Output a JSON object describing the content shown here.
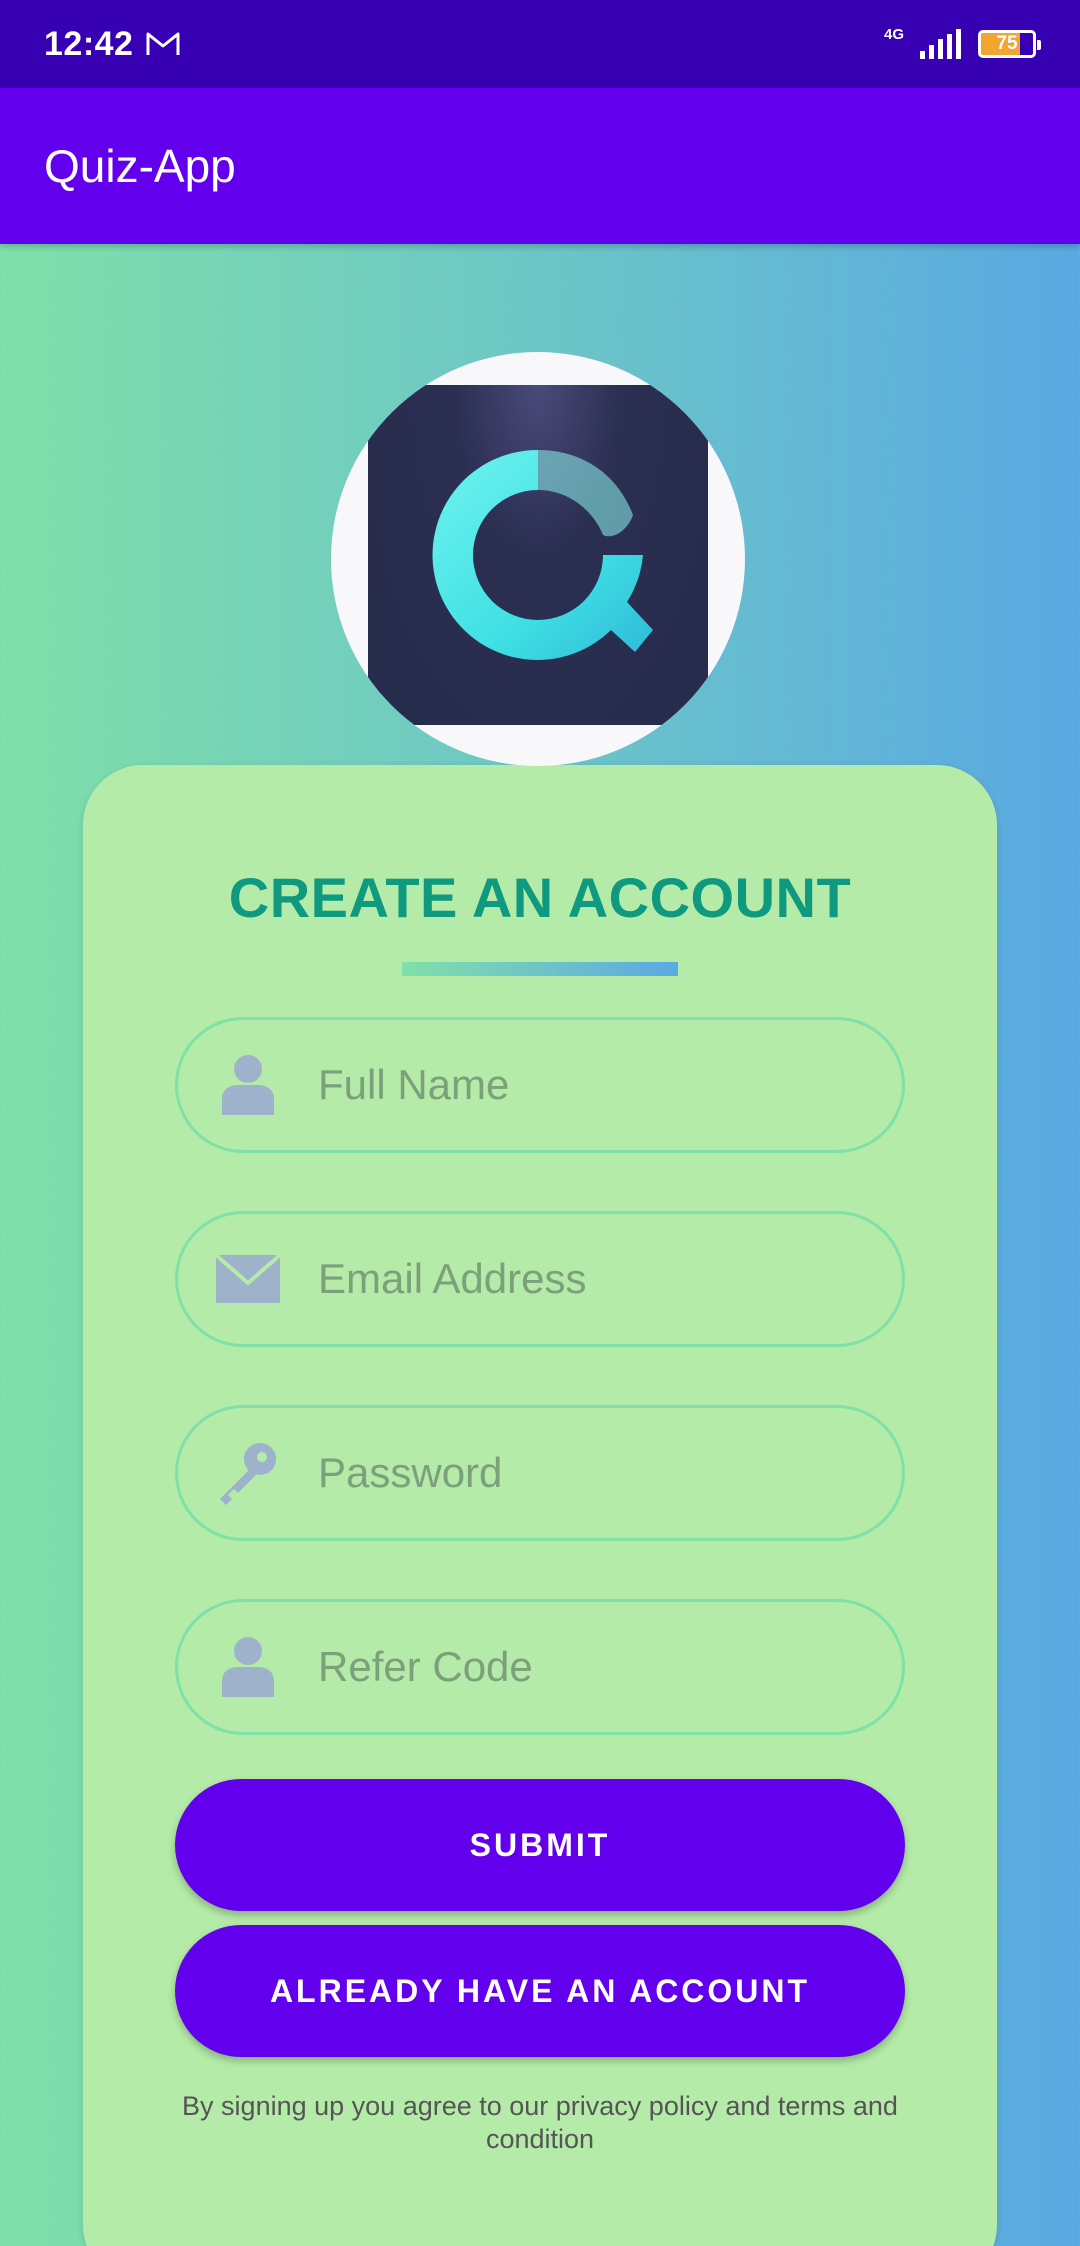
{
  "status_bar": {
    "time": "12:42",
    "network": "4G",
    "battery": "75",
    "battery_color": "#f2a531"
  },
  "app_bar": {
    "title": "Quiz-App"
  },
  "logo": {
    "icon": "quiz-app-logo-q"
  },
  "form": {
    "title": "CREATE AN ACCOUNT",
    "fields": [
      {
        "icon": "person-icon",
        "placeholder": "Full Name",
        "value": ""
      },
      {
        "icon": "mail-icon",
        "placeholder": "Email Address",
        "value": ""
      },
      {
        "icon": "key-icon",
        "placeholder": "Password",
        "value": ""
      },
      {
        "icon": "person-icon",
        "placeholder": "Refer Code",
        "value": ""
      }
    ],
    "submit_label": "SUBMIT",
    "login_label": "ALREADY HAVE AN ACCOUNT",
    "terms": "By signing up you agree to our privacy policy and terms and condition"
  },
  "colors": {
    "primary": "#6200ee",
    "primary_dark": "#3700b3",
    "card": "#b5eba8",
    "title": "#0f9a80",
    "field_border": "#7ee2a8",
    "icon": "#9fb2cc"
  }
}
